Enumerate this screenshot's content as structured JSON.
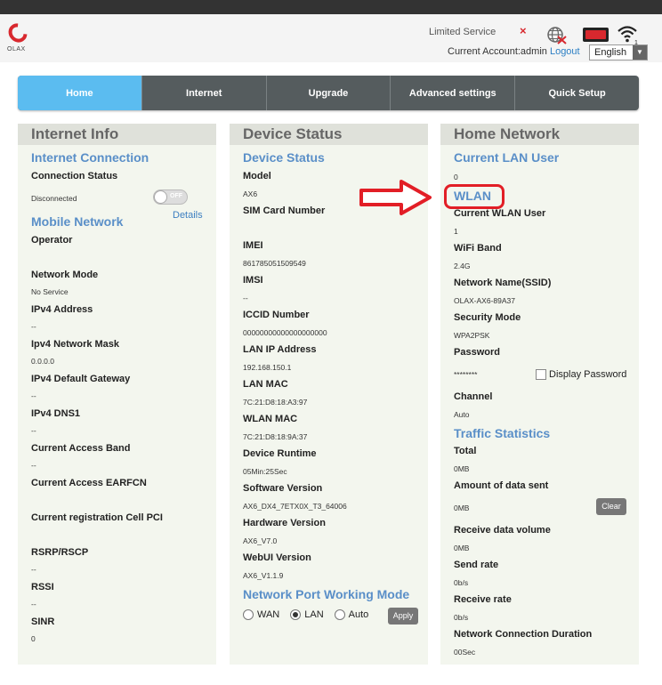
{
  "header": {
    "logo_text": "OLAX",
    "limited_service": "Limited Service",
    "account_label": "Current Account:admin",
    "logout": "Logout",
    "language": "English",
    "icons": [
      "close-icon",
      "globe-icon",
      "battery-icon",
      "wifi-icon"
    ],
    "wifi_clients": "1"
  },
  "nav": {
    "items": [
      "Home",
      "Internet",
      "Upgrade",
      "Advanced settings",
      "Quick Setup"
    ],
    "active": "Home"
  },
  "internet_info": {
    "title": "Internet Info",
    "connection_section": "Internet Connection",
    "connection_status_label": "Connection Status",
    "connection_status_value": "Disconnected",
    "toggle_text": "OFF",
    "mobile_network_section": "Mobile Network",
    "details_link": "Details",
    "operator_label": "Operator",
    "operator_value": "",
    "network_mode_label": "Network Mode",
    "network_mode_value": "No Service",
    "ipv4_address_label": "IPv4 Address",
    "ipv4_address_value": "--",
    "ipv4_mask_label": "Ipv4 Network Mask",
    "ipv4_mask_value": "0.0.0.0",
    "ipv4_gateway_label": "IPv4 Default Gateway",
    "ipv4_gateway_value": "--",
    "ipv4_dns_label": "IPv4 DNS1",
    "ipv4_dns_value": "--",
    "access_band_label": "Current Access Band",
    "access_band_value": "--",
    "earfcn_label": "Current Access EARFCN",
    "earfcn_value": "",
    "cell_pci_label": "Current registration Cell PCI",
    "cell_pci_value": "",
    "rsrp_label": "RSRP/RSCP",
    "rsrp_value": "--",
    "rssi_label": "RSSI",
    "rssi_value": "--",
    "sinr_label": "SINR",
    "sinr_value": "0"
  },
  "device_status": {
    "title": "Device Status",
    "section": "Device Status",
    "model_label": "Model",
    "model_value": "AX6",
    "sim_label": "SIM Card Number",
    "sim_value": "",
    "imei_label": "IMEI",
    "imei_value": "861785051509549",
    "imsi_label": "IMSI",
    "imsi_value": "--",
    "iccid_label": "ICCID Number",
    "iccid_value": "00000000000000000000",
    "lan_ip_label": "LAN IP Address",
    "lan_ip_value": "192.168.150.1",
    "lan_mac_label": "LAN MAC",
    "lan_mac_value": "7C:21:D8:18:A3:97",
    "wlan_mac_label": "WLAN MAC",
    "wlan_mac_value": "7C:21:D8:18:9A:37",
    "runtime_label": "Device Runtime",
    "runtime_value": "05Min:25Sec",
    "sw_label": "Software Version",
    "sw_value": "AX6_DX4_7ETX0X_T3_64006",
    "hw_label": "Hardware Version",
    "hw_value": "AX6_V7.0",
    "webui_label": "WebUI Version",
    "webui_value": "AX6_V1.1.9",
    "port_mode_section": "Network Port Working Mode",
    "port_modes": [
      "WAN",
      "LAN",
      "Auto"
    ],
    "port_mode_selected": "LAN",
    "apply": "Apply"
  },
  "home_network": {
    "title": "Home Network",
    "lan_user_section": "Current LAN User",
    "lan_user_value": "0",
    "wlan_section": "WLAN",
    "wlan_user_label": "Current WLAN User",
    "wlan_user_value": "1",
    "band_label": "WiFi Band",
    "band_value": "2.4G",
    "ssid_label": "Network Name(SSID)",
    "ssid_value": "OLAX-AX6-89A37",
    "security_label": "Security Mode",
    "security_value": "WPA2PSK",
    "password_label": "Password",
    "password_value": "********",
    "display_password": "Display Password",
    "channel_label": "Channel",
    "channel_value": "Auto",
    "traffic_section": "Traffic Statistics",
    "total_label": "Total",
    "total_value": "0MB",
    "sent_label": "Amount of data sent",
    "sent_value": "0MB",
    "clear": "Clear",
    "received_label": "Receive data volume",
    "received_value": "0MB",
    "send_rate_label": "Send rate",
    "send_rate_value": "0b/s",
    "receive_rate_label": "Receive rate",
    "receive_rate_value": "0b/s",
    "duration_label": "Network Connection Duration",
    "duration_value": "00Sec"
  },
  "colors": {
    "accent_blue": "#5bbcf0",
    "nav_bg": "#555c5e",
    "section_blue": "#5a8fc8",
    "highlight_red": "#e21e26",
    "panel_bg": "#f3f6ee"
  }
}
